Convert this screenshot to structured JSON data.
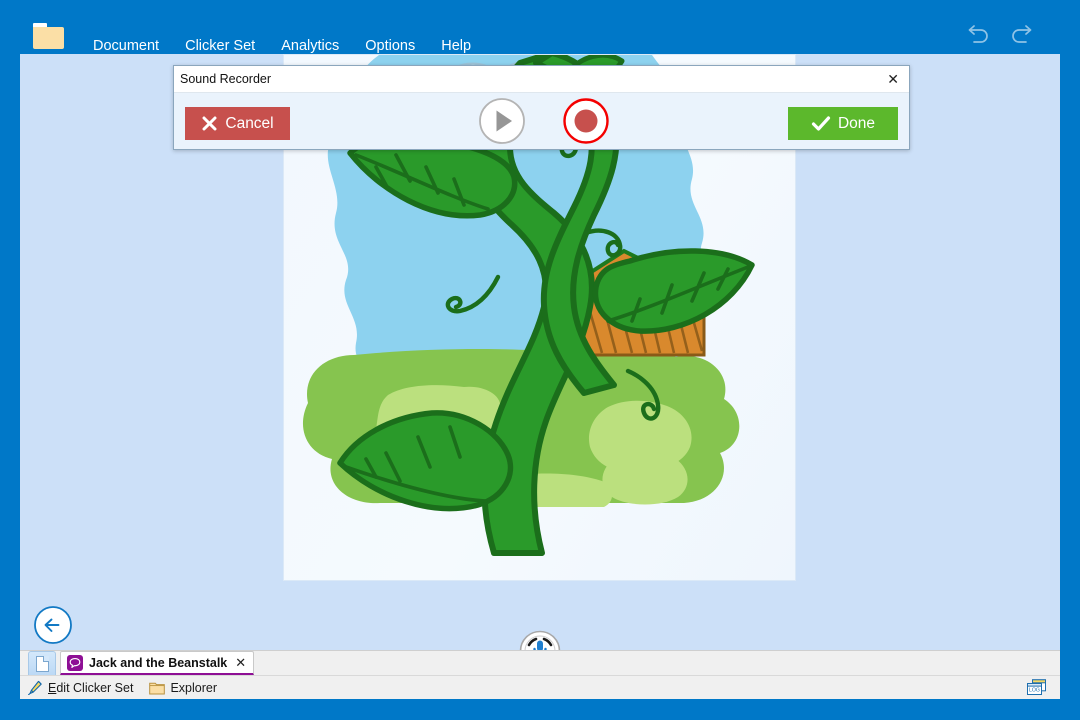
{
  "window": {
    "chrome_color": "#0078c8",
    "content_bg": "#cce0f8"
  },
  "topbar": {
    "folder_icon": "folder-icon",
    "menus": [
      {
        "label": "Document"
      },
      {
        "label": "Clicker Set"
      },
      {
        "label": "Analytics"
      },
      {
        "label": "Options"
      },
      {
        "label": "Help"
      }
    ],
    "undo_icon": "undo-arrow-icon",
    "redo_icon": "redo-arrow-icon"
  },
  "dialog": {
    "title": "Sound Recorder",
    "close_label": "✕",
    "cancel_label": "Cancel",
    "cancel_icon": "cross-icon",
    "cancel_color": "#c7504d",
    "done_label": "Done",
    "done_icon": "check-icon",
    "done_color": "#5cb82c",
    "play_icon": "play-icon",
    "record_icon": "record-icon",
    "record_ring_color": "#f40000",
    "record_fill_color": "#c7504d"
  },
  "document": {
    "illustration_name": "beanstalk-illustration",
    "alt": "Jack and the Beanstalk - green beanstalk growing into clouds over green hills",
    "mic_icon": "microphone-icon",
    "back_icon": "back-arrow-icon"
  },
  "tabs": {
    "doc_tab_icon": "page-icon",
    "items": [
      {
        "label": "Jack and the Beanstalk",
        "icon": "speech-bubble-icon",
        "accent": "#8e0f95",
        "close_label": "✕",
        "active": true
      }
    ]
  },
  "statusbar": {
    "items": [
      {
        "label": "dit Clicker Set",
        "accel": "E",
        "icon": "pencil-icon"
      },
      {
        "label": "Explorer",
        "accel": "",
        "icon": "folder-icon"
      }
    ],
    "log_icon": "log-window-icon",
    "log_text": "LOG"
  }
}
